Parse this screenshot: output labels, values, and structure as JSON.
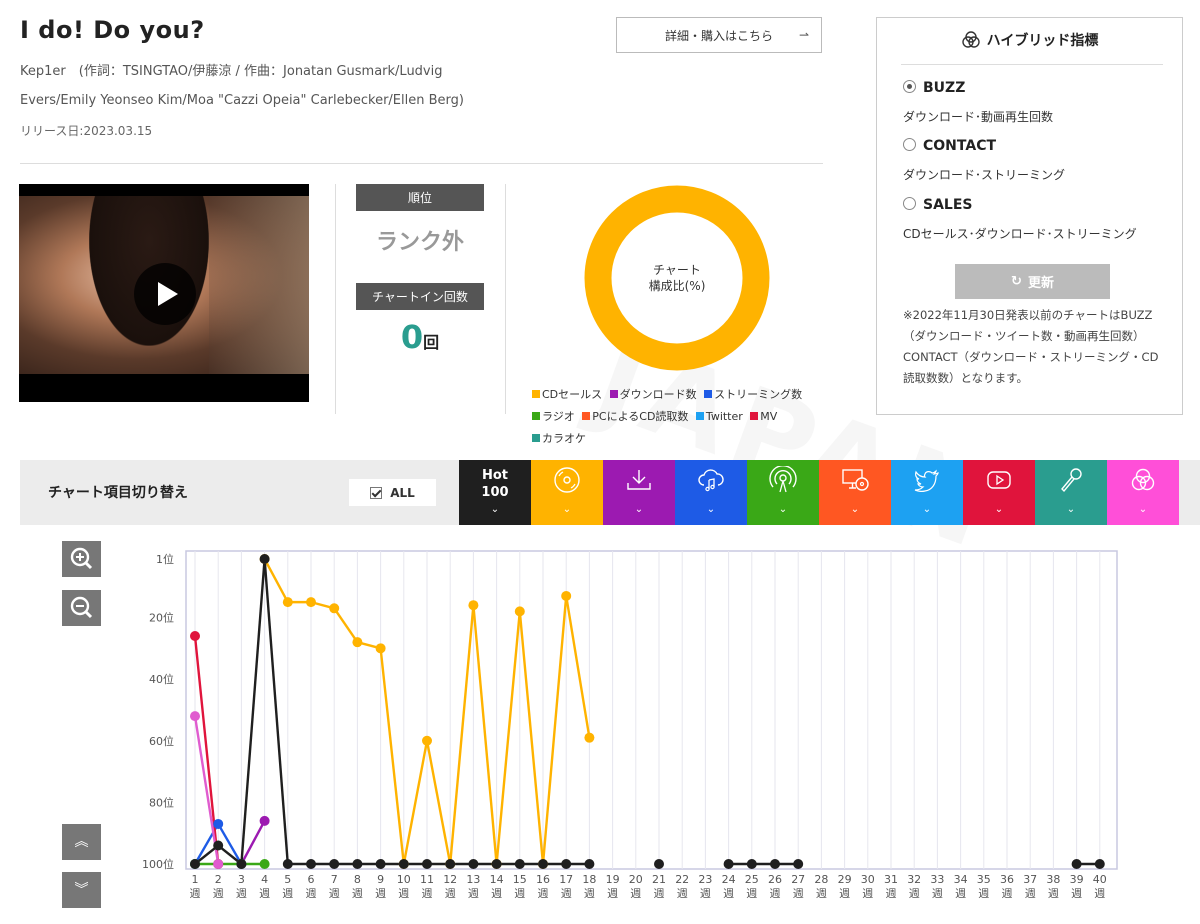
{
  "song": {
    "title": "I do! Do you?",
    "credits": "Kep1er　(作詞：TSINGTAO/伊藤涼 / 作曲：Jonatan Gusmark/Ludvig Evers/Emily Yeonseo Kim/Moa \"Cazzi Opeia\" Carlebecker/Ellen Berg)",
    "release_date": "リリース日:2023.03.15"
  },
  "detail_link": {
    "label": "詳細・購入はこちら"
  },
  "rank": {
    "label": "順位",
    "value": "ランク外"
  },
  "chartin": {
    "label": "チャートイン回数",
    "count": "0",
    "unit": "回"
  },
  "composition": {
    "center_line1": "チャート",
    "center_line2": "構成比(%)",
    "color": "#ffb300"
  },
  "legend": [
    {
      "label": "CDセールス",
      "color": "#ffb300"
    },
    {
      "label": "ダウンロード数",
      "color": "#9c1ab1"
    },
    {
      "label": "ストリーミング数",
      "color": "#1e5be6"
    },
    {
      "label": "ラジオ",
      "color": "#3aa817"
    },
    {
      "label": "PCによるCD読取数",
      "color": "#ff5722"
    },
    {
      "label": "Twitter",
      "color": "#1da1f2"
    },
    {
      "label": "MV",
      "color": "#e0143c"
    },
    {
      "label": "カラオケ",
      "color": "#2a9d8f"
    }
  ],
  "hybrid": {
    "title": "ハイブリッド指標",
    "options": [
      {
        "label": "BUZZ",
        "desc": "ダウンロード･動画再生回数",
        "selected": true
      },
      {
        "label": "CONTACT",
        "desc": "ダウンロード･ストリーミング",
        "selected": false
      },
      {
        "label": "SALES",
        "desc": "CDセールス･ダウンロード･ストリーミング",
        "selected": false
      }
    ],
    "update_label": "更新",
    "note": "※2022年11月30日発表以前のチャートはBUZZ（ダウンロード・ツイート数・動画再生回数）CONTACT（ダウンロード・ストリーミング・CD読取数数）となります。"
  },
  "chart_switch": {
    "label": "チャート項目切り替え",
    "all_label": "ALL",
    "hot_line1": "Hot",
    "hot_line2": "100",
    "tabs": [
      {
        "icon": "hot100-icon",
        "color": "#1f1f1f"
      },
      {
        "icon": "cd-icon",
        "color": "#ffb300"
      },
      {
        "icon": "download-icon",
        "color": "#9c1ab1"
      },
      {
        "icon": "streaming-icon",
        "color": "#1e5be6"
      },
      {
        "icon": "radio-icon",
        "color": "#3aa817"
      },
      {
        "icon": "pc-cd-read-icon",
        "color": "#ff5722"
      },
      {
        "icon": "twitter-icon",
        "color": "#1da1f2"
      },
      {
        "icon": "mv-icon",
        "color": "#e0143c"
      },
      {
        "icon": "karaoke-icon",
        "color": "#2a9d8f"
      },
      {
        "icon": "hybrid-icon",
        "color": "#ff4fd8"
      }
    ]
  },
  "chart_data": {
    "type": "line",
    "x": [
      1,
      2,
      3,
      4,
      5,
      6,
      7,
      8,
      9,
      10,
      11,
      12,
      13,
      14,
      15,
      16,
      17,
      18,
      19,
      20,
      21,
      22,
      23,
      24,
      25,
      26,
      27,
      28,
      29,
      30,
      31,
      32,
      33,
      34,
      35,
      36,
      37,
      38,
      39,
      40
    ],
    "week_unit": "週",
    "y_ticks": [
      {
        "value": 1,
        "label": "1位"
      },
      {
        "value": 20,
        "label": "20位"
      },
      {
        "value": 40,
        "label": "40位"
      },
      {
        "value": 60,
        "label": "60位"
      },
      {
        "value": 80,
        "label": "80位"
      },
      {
        "value": 100,
        "label": "100位"
      }
    ],
    "ylim": [
      1,
      100
    ],
    "y_inverted": true,
    "series": [
      {
        "key": "cd",
        "color": "#ffb300",
        "points": [
          [
            4,
            1
          ],
          [
            5,
            15
          ],
          [
            6,
            15
          ],
          [
            7,
            17
          ],
          [
            8,
            28
          ],
          [
            9,
            30
          ],
          [
            10,
            100
          ],
          [
            11,
            60
          ],
          [
            12,
            100
          ],
          [
            13,
            16
          ],
          [
            14,
            100
          ],
          [
            15,
            18
          ],
          [
            16,
            100
          ],
          [
            17,
            13
          ],
          [
            18,
            59
          ]
        ]
      },
      {
        "key": "download",
        "color": "#9c1ab1",
        "points": [
          [
            3,
            100
          ],
          [
            4,
            86
          ]
        ]
      },
      {
        "key": "streaming",
        "color": "#1e5be6",
        "points": [
          [
            1,
            100
          ],
          [
            2,
            87
          ],
          [
            3,
            100
          ]
        ]
      },
      {
        "key": "radio",
        "color": "#3aa817",
        "points": [
          [
            1,
            100
          ],
          [
            2,
            100
          ],
          [
            3,
            100
          ],
          [
            4,
            100
          ]
        ]
      },
      {
        "key": "mv",
        "color": "#e0143c",
        "points": [
          [
            1,
            26
          ],
          [
            2,
            100
          ]
        ]
      },
      {
        "key": "hybrid",
        "color": "#e05ccf",
        "points": [
          [
            1,
            52
          ],
          [
            2,
            100
          ]
        ]
      },
      {
        "key": "hot100",
        "color": "#1f1f1f",
        "points": [
          [
            1,
            100
          ],
          [
            2,
            94
          ],
          [
            3,
            100
          ],
          [
            4,
            1
          ],
          [
            5,
            100
          ],
          [
            6,
            100
          ],
          [
            7,
            100
          ],
          [
            8,
            100
          ],
          [
            9,
            100
          ],
          [
            10,
            100
          ],
          [
            11,
            100
          ],
          [
            12,
            100
          ],
          [
            13,
            100
          ],
          [
            14,
            100
          ],
          [
            15,
            100
          ],
          [
            16,
            100
          ],
          [
            17,
            100
          ],
          [
            18,
            100
          ],
          [
            21,
            100
          ],
          [
            24,
            100
          ],
          [
            25,
            100
          ],
          [
            26,
            100
          ],
          [
            27,
            100
          ],
          [
            39,
            100
          ],
          [
            40,
            100
          ]
        ]
      }
    ]
  }
}
